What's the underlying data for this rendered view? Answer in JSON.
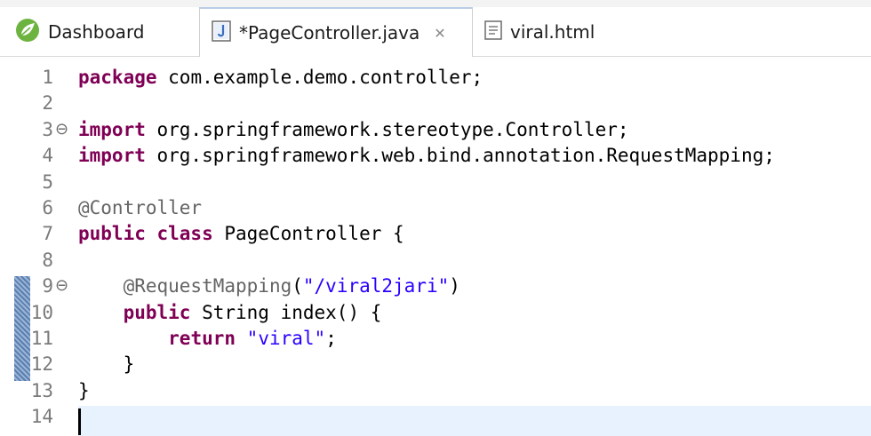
{
  "tabs": [
    {
      "label": "Dashboard",
      "icon": "spring-icon"
    },
    {
      "label": "*PageController.java",
      "icon": "java-file-icon",
      "close": "✕"
    },
    {
      "label": "viral.html",
      "icon": "html-file-icon"
    }
  ],
  "colors": {
    "keyword": "#7f0055",
    "string": "#2a00ff",
    "annotation": "#646464",
    "current_line": "#e8f2fe"
  },
  "code_lines": [
    {
      "num": "1",
      "parts": [
        [
          "kw",
          "package"
        ],
        [
          "t",
          " com.example.demo.controller;"
        ]
      ]
    },
    {
      "num": "2",
      "parts": []
    },
    {
      "num": "3",
      "fold": "⊖",
      "parts": [
        [
          "kw",
          "import"
        ],
        [
          "t",
          " org.springframework.stereotype.Controller;"
        ]
      ]
    },
    {
      "num": "4",
      "parts": [
        [
          "kw",
          "import"
        ],
        [
          "t",
          " org.springframework.web.bind.annotation.RequestMapping;"
        ]
      ]
    },
    {
      "num": "5",
      "parts": []
    },
    {
      "num": "6",
      "parts": [
        [
          "ann",
          "@Controller"
        ]
      ]
    },
    {
      "num": "7",
      "parts": [
        [
          "kw",
          "public class"
        ],
        [
          "t",
          " PageController {"
        ]
      ]
    },
    {
      "num": "8",
      "parts": []
    },
    {
      "num": "9",
      "fold": "⊖",
      "parts": [
        [
          "t",
          "    "
        ],
        [
          "ann",
          "@RequestMapping"
        ],
        [
          "t",
          "("
        ],
        [
          "str",
          "\"/viral2jari\""
        ],
        [
          "t",
          ")"
        ]
      ]
    },
    {
      "num": "10",
      "parts": [
        [
          "t",
          "    "
        ],
        [
          "kw",
          "public"
        ],
        [
          "t",
          " String index() {"
        ]
      ]
    },
    {
      "num": "11",
      "parts": [
        [
          "t",
          "        "
        ],
        [
          "kw",
          "return"
        ],
        [
          "t",
          " "
        ],
        [
          "str",
          "\"viral\""
        ],
        [
          "t",
          ";"
        ]
      ]
    },
    {
      "num": "12",
      "parts": [
        [
          "t",
          "    }"
        ]
      ]
    },
    {
      "num": "13",
      "parts": [
        [
          "t",
          "}"
        ]
      ]
    },
    {
      "num": "14",
      "parts": []
    }
  ]
}
